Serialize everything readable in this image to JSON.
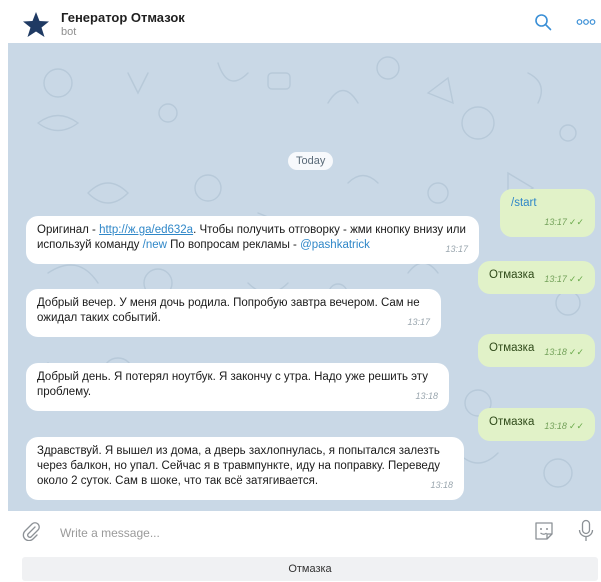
{
  "header": {
    "title": "Генератор Отмазок",
    "subtitle": "bot",
    "avatar_icon": "star-icon",
    "search_icon": "search-icon",
    "more_icon": "more-icon"
  },
  "chat": {
    "date_separator": "Today",
    "messages": [
      {
        "direction": "out",
        "text": "/start",
        "time": "13:17"
      },
      {
        "direction": "in",
        "part1": "Оригинал - ",
        "link": "http://ж.ga/ed632a",
        "part2": ". Чтобы получить отговорку - жми кнопку внизу или используй команду ",
        "cmd": "/new",
        "part3": " По вопросам рекламы - ",
        "mention": "@pashkatrick",
        "time": "13:17"
      },
      {
        "direction": "out",
        "text": "Отмазка",
        "time": "13:17"
      },
      {
        "direction": "in",
        "text": "Добрый вечер. У меня дочь родила. Попробую завтра вечером. Сам не ожидал таких событий.",
        "time": "13:17"
      },
      {
        "direction": "out",
        "text": "Отмазка",
        "time": "13:18"
      },
      {
        "direction": "in",
        "text": "Добрый день. Я потерял ноутбук. Я закончу с утра. Надо уже решить эту проблему.",
        "time": "13:18"
      },
      {
        "direction": "out",
        "text": "Отмазка",
        "time": "13:18"
      },
      {
        "direction": "in",
        "text": "Здравствуй. Я вышел из дома, а дверь захлопнулась, я попытался залезть через балкон, но упал. Сейчас я в травмпункте, иду на поправку. Переведу около 2 суток. Сам в шоке, что так всё затягивается.",
        "time": "13:18"
      }
    ]
  },
  "composer": {
    "placeholder": "Write a message...",
    "attach_icon": "paperclip-icon",
    "sticker_icon": "sticker-icon",
    "mic_icon": "microphone-icon"
  },
  "keyboard": {
    "button_label": "Отмазка"
  },
  "colors": {
    "chat_background": "#c9d8e6",
    "incoming_bubble": "#ffffff",
    "outgoing_bubble": "#e1f2c8",
    "accent": "#2f87c8",
    "read_check": "#6aaa4a"
  }
}
